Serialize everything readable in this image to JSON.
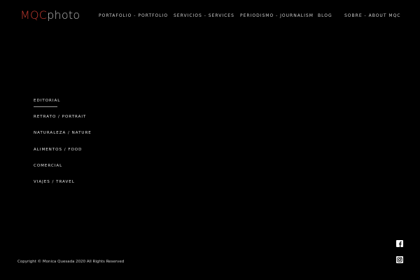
{
  "logo": {
    "brand": "MQC",
    "rest": "photo"
  },
  "nav": {
    "items": [
      {
        "label": "PORTAFOLIO - PORTFOLIO"
      },
      {
        "label": "SERVICIOS - SERVICES"
      },
      {
        "label": "PERIODISMO - JOURNALISM"
      },
      {
        "label": "BLOG"
      },
      {
        "label": "SOBRE - ABOUT MQC"
      }
    ]
  },
  "portfolio_menu": {
    "items": [
      {
        "label": "EDITORIAL",
        "active": true
      },
      {
        "label": "RETRATO / PORTRAIT"
      },
      {
        "label": "NATURALEZA / NATURE"
      },
      {
        "label": "ALIMENTOS / FOOD"
      },
      {
        "label": "COMERCIAL"
      },
      {
        "label": "VIAJES / TRAVEL"
      }
    ]
  },
  "footer": {
    "copyright": "Copyright © Monica Quesada 2020 All Rights Reserved"
  },
  "social": {
    "icons": [
      "facebook-icon",
      "instagram-icon"
    ]
  },
  "colors": {
    "background": "#000000",
    "brand_accent": "#c0392f",
    "text": "#cfcfcf"
  }
}
